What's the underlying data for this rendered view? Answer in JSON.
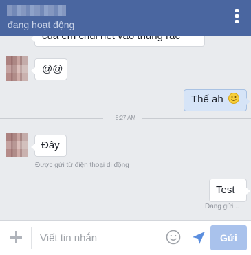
{
  "header": {
    "status": "đang hoạt động",
    "menu_icon": "overflow-menu-icon"
  },
  "messages": [
    {
      "text": "của em chui hết vào thùng rác"
    },
    {
      "text": "@@"
    },
    {
      "text": "Thế ah",
      "emoji": "smiley-icon"
    },
    {
      "text": "Đây",
      "meta": "Được gửi từ điện thoại di động"
    },
    {
      "text": "Test",
      "meta": "Đang gửi..."
    }
  ],
  "divider": {
    "time": "8:27 AM"
  },
  "composer": {
    "placeholder": "Viết tin nhắn",
    "send_label": "Gửi",
    "icons": [
      "plus-icon",
      "emoji-icon",
      "location-arrow-icon"
    ]
  },
  "colors": {
    "header": "#4a66a0",
    "background": "#e9ebee",
    "outgoing_bubble": "#d6e4f7",
    "send_button": "#a9c2ec"
  }
}
